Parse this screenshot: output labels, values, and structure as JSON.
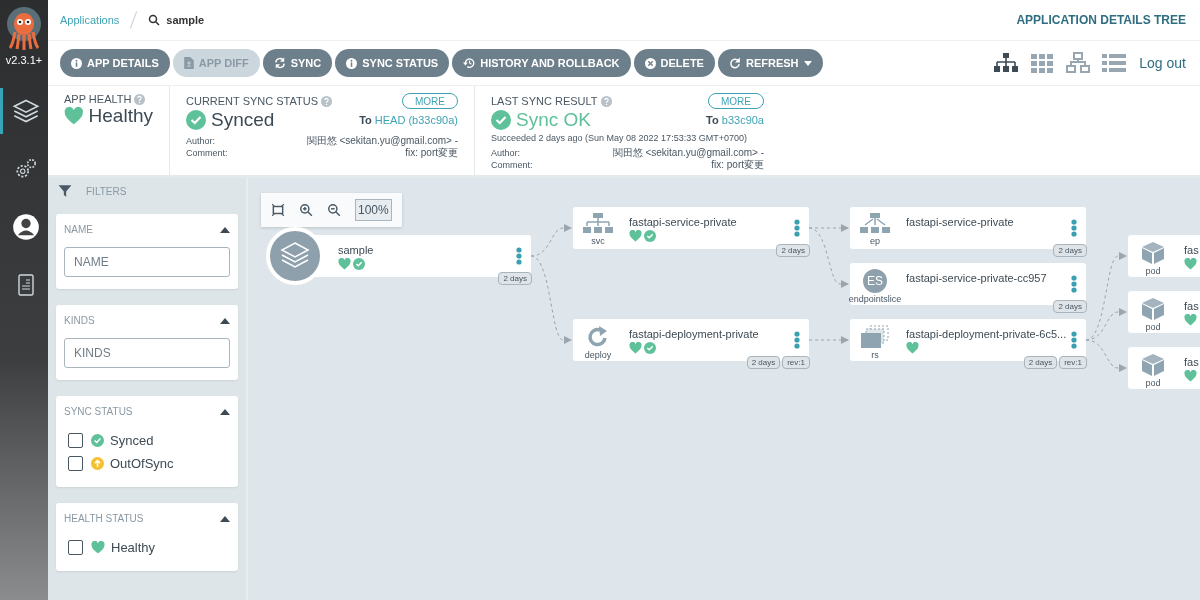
{
  "sidebar": {
    "version": "v2.3.1+",
    "nav": [
      {
        "kind": "applications",
        "selected": true
      },
      {
        "kind": "settings",
        "selected": false
      },
      {
        "kind": "user",
        "selected": false
      },
      {
        "kind": "docs",
        "selected": false
      }
    ]
  },
  "breadcrumb": {
    "parent": "Applications",
    "current": "sample"
  },
  "page_title": "APPLICATION DETAILS TREE",
  "toolbar": {
    "buttons": [
      {
        "kind": "info",
        "label": "APP DETAILS",
        "disabled": false
      },
      {
        "kind": "diff",
        "label": "APP DIFF",
        "disabled": true
      },
      {
        "kind": "sync",
        "label": "SYNC",
        "disabled": false
      },
      {
        "kind": "info",
        "label": "SYNC STATUS",
        "disabled": false
      },
      {
        "kind": "history",
        "label": "HISTORY AND ROLLBACK",
        "disabled": false
      },
      {
        "kind": "delete",
        "label": "DELETE",
        "disabled": false
      },
      {
        "kind": "refresh",
        "label": "REFRESH",
        "disabled": false
      }
    ],
    "views": [
      {
        "kind": "tree",
        "selected": true
      },
      {
        "kind": "pods",
        "selected": false
      },
      {
        "kind": "network",
        "selected": false
      },
      {
        "kind": "list",
        "selected": false
      }
    ],
    "logout": "Log out"
  },
  "app_health": {
    "label": "APP HEALTH",
    "value": "Healthy"
  },
  "current_sync": {
    "label": "CURRENT SYNC STATUS",
    "more": "MORE",
    "value": "Synced",
    "to": "To",
    "revision": "HEAD (b33c90a)",
    "author_label": "Author:",
    "comment_label": "Comment:",
    "author": "関田悠 <sekitan.yu@gmail.com> -",
    "comment": "fix: port変更"
  },
  "last_sync": {
    "label": "LAST SYNC RESULT",
    "more": "MORE",
    "value": "Sync OK",
    "to": "To",
    "revision": "b33c90a",
    "succeeded": "Succeeded 2 days ago (Sun May 08 2022 17:53:33 GMT+0700)",
    "author_label": "Author:",
    "comment_label": "Comment:",
    "author": "関田悠 <sekitan.yu@gmail.com> -",
    "comment": "fix: port変更"
  },
  "filters": {
    "title": "FILTERS",
    "sections": [
      {
        "kind": "input",
        "title": "NAME",
        "placeholder": "NAME"
      },
      {
        "kind": "input",
        "title": "KINDS",
        "placeholder": "KINDS"
      },
      {
        "kind": "checks",
        "title": "SYNC STATUS",
        "options": [
          {
            "kind": "synced",
            "label": "Synced",
            "checked": false
          },
          {
            "kind": "outofsync",
            "label": "OutOfSync",
            "checked": false
          }
        ]
      },
      {
        "kind": "checks",
        "title": "HEALTH STATUS",
        "options": [
          {
            "kind": "healthy",
            "label": "Healthy",
            "checked": false
          }
        ]
      }
    ]
  },
  "canvas": {
    "zoom": "100%",
    "root": {
      "kind": "app",
      "name": "sample",
      "healthy": true,
      "synced": true,
      "age": "2 days",
      "children": [
        {
          "kind": "svc",
          "type": "svc",
          "name": "fastapi-service-private",
          "healthy": true,
          "synced": true,
          "age": "2 days",
          "children": [
            {
              "kind": "ep",
              "type": "ep",
              "name": "fastapi-service-private",
              "healthy": false,
              "synced": false,
              "age": "2 days"
            },
            {
              "kind": "es",
              "type": "endpointslice",
              "abbr": "ES",
              "name": "fastapi-service-private-cc957",
              "healthy": false,
              "synced": false,
              "age": "2 days"
            }
          ]
        },
        {
          "kind": "deploy",
          "type": "deploy",
          "name": "fastapi-deployment-private",
          "healthy": true,
          "synced": true,
          "age": "2 days",
          "revision": "rev:1",
          "children": [
            {
              "kind": "rs",
              "type": "rs",
              "name": "fastapi-deployment-private-6c5...",
              "healthy": true,
              "synced": false,
              "age": "2 days",
              "revision": "rev:1",
              "children": [
                {
                  "kind": "pod",
                  "type": "pod",
                  "name": "fas",
                  "healthy": true,
                  "synced": false
                },
                {
                  "kind": "pod",
                  "type": "pod",
                  "name": "fas",
                  "healthy": true,
                  "synced": false
                },
                {
                  "kind": "pod",
                  "type": "pod",
                  "name": "fas",
                  "healthy": true,
                  "synced": false
                }
              ]
            }
          ]
        }
      ]
    }
  }
}
